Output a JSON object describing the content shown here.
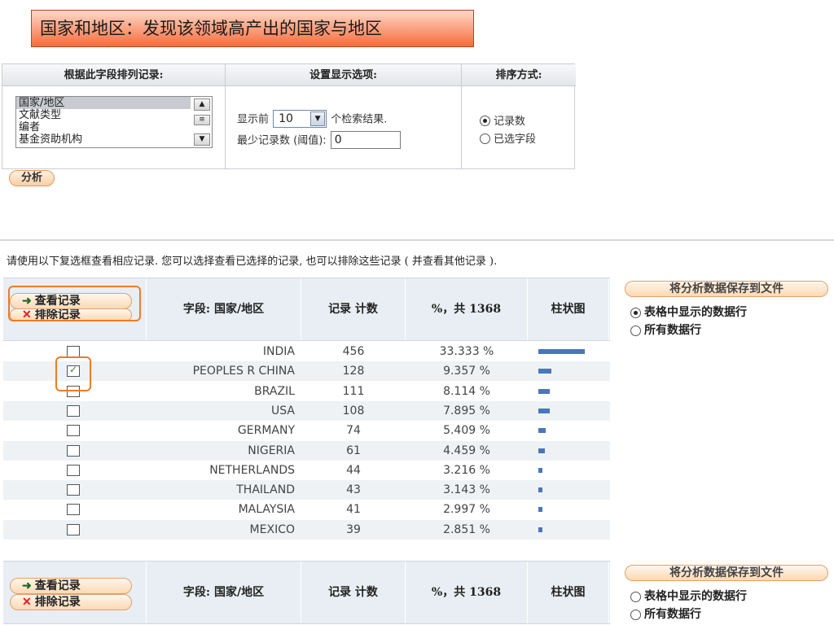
{
  "banner": {
    "title": "国家和地区：发现该领域高产出的国家与地区"
  },
  "settings": {
    "headers": {
      "rank_by": "根据此字段排列记录:",
      "display": "设置显示选项:",
      "sort": "排序方式:"
    },
    "fields": [
      {
        "label": "国家/地区",
        "selected": true
      },
      {
        "label": "文献类型",
        "selected": false
      },
      {
        "label": "编者",
        "selected": false
      },
      {
        "label": "基金资助机构",
        "selected": false
      }
    ],
    "show_top_prefix": "显示前",
    "show_top_value": "10",
    "show_top_suffix": "个检索结果.",
    "min_records_label": "最少记录数 (阈值):",
    "min_records_value": "0",
    "sort_options": [
      {
        "label": "记录数",
        "checked": true
      },
      {
        "label": "已选字段",
        "checked": false
      }
    ],
    "analyze_button": "分析"
  },
  "instruction": "请使用以下复选框查看相应记录. 您可以选择查看已选择的记录, 也可以排除这些记录 ( 并查看其他记录 ).",
  "results": {
    "view_button": "查看记录",
    "exclude_button": "排除记录",
    "columns": [
      "字段: 国家/地区",
      "记录 计数",
      "%，共 1368",
      "柱状图"
    ],
    "save_button": "将分析数据保存到文件",
    "save_options": [
      {
        "label": "表格中显示的数据行",
        "checked": true
      },
      {
        "label": "所有数据行",
        "checked": false
      }
    ],
    "footer_save_options": [
      {
        "label": "表格中显示的数据行",
        "checked": false
      },
      {
        "label": "所有数据行",
        "checked": false
      }
    ],
    "rows": [
      {
        "country": "INDIA",
        "count": "456",
        "percent": "33.333 %",
        "bar": 33.333,
        "checked": false
      },
      {
        "country": "PEOPLES R CHINA",
        "count": "128",
        "percent": "9.357 %",
        "bar": 9.357,
        "checked": true
      },
      {
        "country": "BRAZIL",
        "count": "111",
        "percent": "8.114 %",
        "bar": 8.114,
        "checked": false
      },
      {
        "country": "USA",
        "count": "108",
        "percent": "7.895 %",
        "bar": 7.895,
        "checked": false
      },
      {
        "country": "GERMANY",
        "count": "74",
        "percent": "5.409 %",
        "bar": 5.409,
        "checked": false
      },
      {
        "country": "NIGERIA",
        "count": "61",
        "percent": "4.459 %",
        "bar": 4.459,
        "checked": false
      },
      {
        "country": "NETHERLANDS",
        "count": "44",
        "percent": "3.216 %",
        "bar": 3.216,
        "checked": false
      },
      {
        "country": "THAILAND",
        "count": "43",
        "percent": "3.143 %",
        "bar": 3.143,
        "checked": false
      },
      {
        "country": "MALAYSIA",
        "count": "41",
        "percent": "2.997 %",
        "bar": 2.997,
        "checked": false
      },
      {
        "country": "MEXICO",
        "count": "39",
        "percent": "2.851 %",
        "bar": 2.851,
        "checked": false
      }
    ]
  },
  "colors": {
    "banner_top": "#ffd9c8",
    "banner_bottom": "#f66b3c",
    "bar": "#4b76b8",
    "highlight": "#f07b25",
    "header_bg": "#e8eef3"
  }
}
